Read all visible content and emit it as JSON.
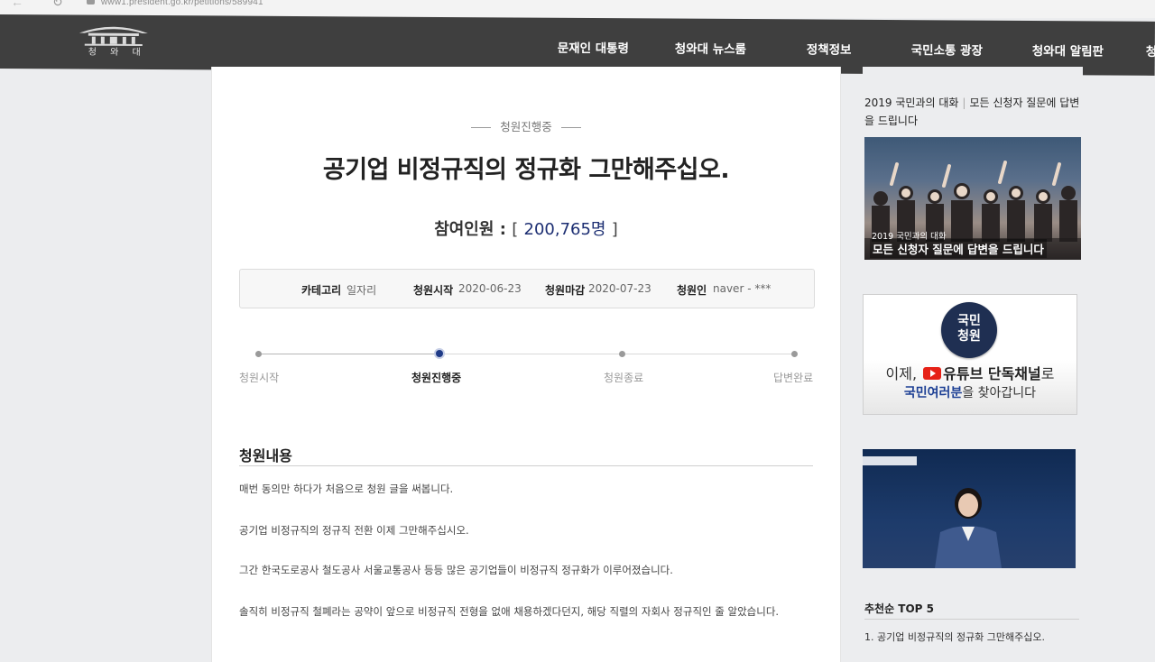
{
  "browser": {
    "url": "www1.president.go.kr/petitions/589941"
  },
  "header": {
    "logo_text": "청 와 대",
    "nav": [
      "문재인 대통령",
      "청와대 뉴스룸",
      "정책정보",
      "국민소통 광장",
      "청와대 알림판",
      "청"
    ]
  },
  "petition": {
    "status": "청원진행중",
    "title": "공기업 비정규직의 정규화 그만해주십오.",
    "participants_label": "참여인원 :",
    "participants_value": "200,765명",
    "info": {
      "category_label": "카테고리",
      "category_value": "일자리",
      "start_label": "청원시작",
      "start_value": "2020-06-23",
      "end_label": "청원마감",
      "end_value": "2020-07-23",
      "author_label": "청원인",
      "author_value": "naver - ***"
    },
    "progress": {
      "steps": [
        "청원시작",
        "청원진행중",
        "청원종료",
        "답변완료"
      ],
      "active_index": 1
    },
    "content_title": "청원내용",
    "content": [
      "매번 동의만 하다가 처음으로 청원 글을 써봅니다.",
      "공기업 비정규직의 정규직 전환 이제 그만해주십시오.",
      "그간 한국도로공사 철도공사 서울교통공사 등등 많은 공기업들이 비정규직 정규화가 이루어졌습니다.",
      "솔직히 비정규직 철폐라는 공약이 앞으로 비정규직 전형을 없애 채용하겠다던지, 해당 직렬의 자회사 정규직인 줄 알았습니다."
    ]
  },
  "sidebar": {
    "heading_left": "2019 국민과의 대화",
    "heading_right": "모든 신청자 질문에 답변을 드립니다",
    "banner1_caption_small": "2019 국민과의 대화",
    "banner1_caption": "모든 신청자 질문에 답변을 드립니다",
    "banner2_badge_line1": "국민",
    "banner2_badge_line2": "청원",
    "banner2_line1_a": "이제,",
    "banner2_line1_b": "유튜브 단독채널",
    "banner2_line1_c": "로",
    "banner2_line2_a": "국민여러분",
    "banner2_line2_b": "을 찾아갑니다",
    "top5_title": "추천순 TOP 5",
    "top5": [
      "1. 공기업 비정규직의 정규화 그만해주십오."
    ]
  }
}
